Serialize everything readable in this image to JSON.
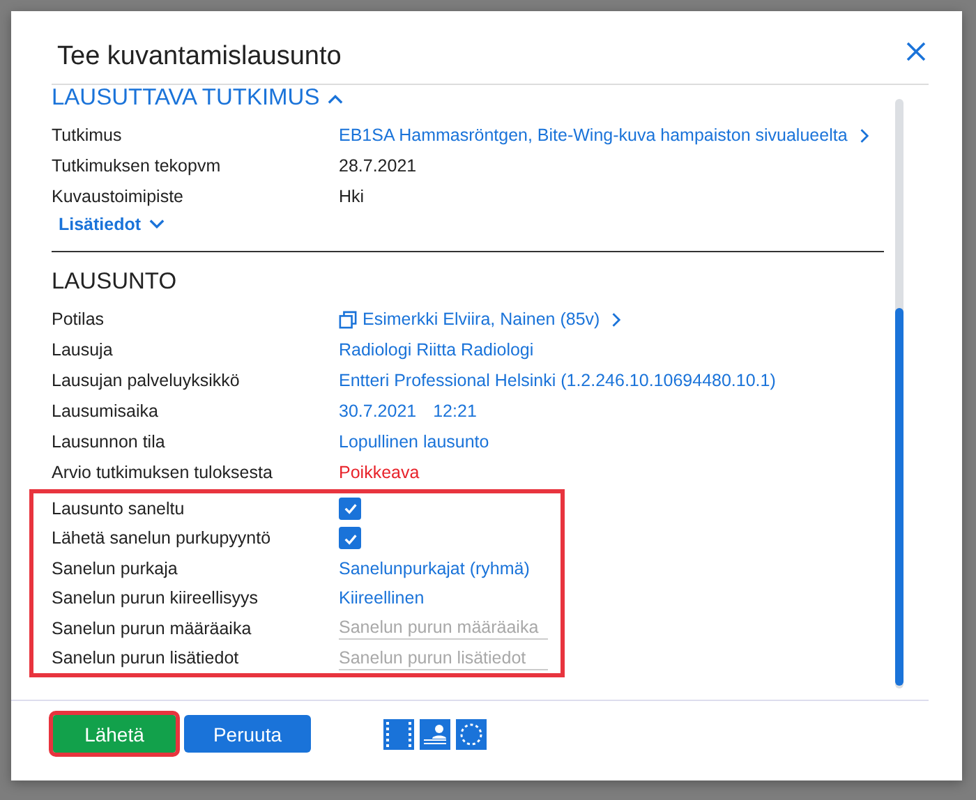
{
  "dialog": {
    "title": "Tee kuvantamislausunto"
  },
  "study_section": {
    "heading": "LAUSUTTAVA TUTKIMUS",
    "expanded": true,
    "rows": [
      {
        "label": "Tutkimus",
        "value": "EB1SA Hammasröntgen, Bite-Wing-kuva hampaiston sivualueelta",
        "kind": "nav-link"
      },
      {
        "label": "Tutkimuksen tekopvm",
        "value": "28.7.2021",
        "kind": "text"
      },
      {
        "label": "Kuvaustoimipiste",
        "value": "Hki",
        "kind": "text"
      }
    ],
    "more": {
      "label": "Lisätiedot",
      "expanded": false
    }
  },
  "statement_section": {
    "heading": "LAUSUNTO",
    "rows": [
      {
        "label": "Potilas",
        "value": "Esimerkki Elviira, Nainen (85v)",
        "kind": "patient-link"
      },
      {
        "label": "Lausuja",
        "value": "Radiologi Riitta Radiologi",
        "kind": "link"
      },
      {
        "label": "Lausujan palveluyksikkö",
        "value": "Entteri Professional Helsinki (1.2.246.10.10694480.10.1)",
        "kind": "link"
      },
      {
        "label": "Lausumisaika",
        "value": "30.7.2021",
        "time": "12:21",
        "kind": "datetime"
      },
      {
        "label": "Lausunnon tila",
        "value": "Lopullinen lausunto",
        "kind": "link"
      },
      {
        "label": "Arvio tutkimuksen tuloksesta",
        "value": "Poikkeava",
        "kind": "alert"
      }
    ],
    "highlighted_rows": [
      {
        "label": "Lausunto saneltu",
        "kind": "checkbox",
        "checked": true
      },
      {
        "label": "Lähetä sanelun purkupyyntö",
        "kind": "checkbox",
        "checked": true
      },
      {
        "label": "Sanelun purkaja",
        "value": "Sanelunpurkajat (ryhmä)",
        "kind": "link"
      },
      {
        "label": "Sanelun purun kiireellisyys",
        "value": "Kiireellinen",
        "kind": "link"
      },
      {
        "label": "Sanelun purun määräaika",
        "placeholder": "Sanelun purun määräaika",
        "kind": "field"
      },
      {
        "label": "Sanelun purun lisätiedot",
        "placeholder": "Sanelun purun lisätiedot",
        "kind": "field"
      }
    ]
  },
  "buttons": [
    {
      "label": "Lähetä",
      "kind": "primary",
      "highlighted": true
    },
    {
      "label": "Peruuta",
      "kind": "secondary",
      "highlighted": false
    }
  ]
}
